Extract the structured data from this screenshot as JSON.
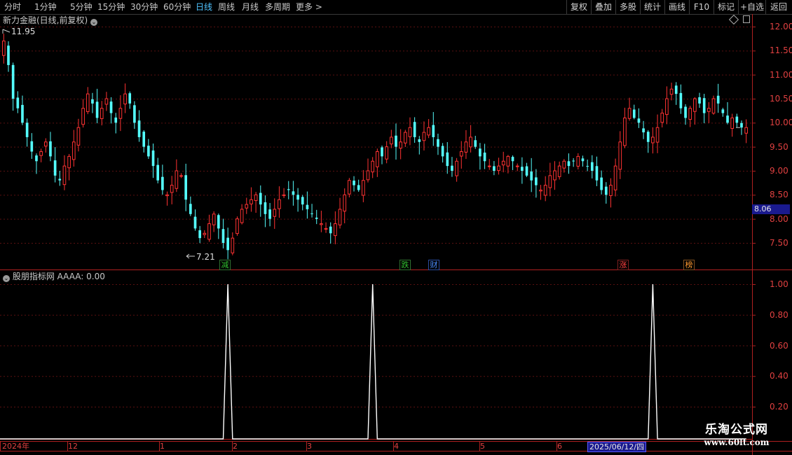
{
  "toolbar": {
    "periods": [
      "分时",
      "1分钟",
      "5分钟",
      "15分钟",
      "30分钟",
      "60分钟",
      "日线",
      "周线",
      "月线",
      "多周期",
      "更多 >"
    ],
    "active": "日线",
    "actions": [
      "复权",
      "叠加",
      "多股",
      "统计",
      "画线",
      "F10",
      "标记",
      "+自选",
      "返回"
    ]
  },
  "main_panel": {
    "title": "新力金融(日线,前复权)"
  },
  "indicator_panel": {
    "title": "股朋指标网  AAAA: 0.00"
  },
  "annotations": {
    "high": "11.95",
    "low": "7.21"
  },
  "price_tag": "8.06",
  "date_tag": "2025/06/12/四",
  "events": [
    {
      "label": "减",
      "color": "#30c030"
    },
    {
      "label": "跌",
      "color": "#30c030"
    },
    {
      "label": "财",
      "color": "#4a8cff"
    },
    {
      "label": "涨",
      "color": "#ff4040"
    },
    {
      "label": "榜",
      "color": "#ff9a30"
    }
  ],
  "x_axis": [
    "2024年",
    "12",
    "1",
    "2",
    "3",
    "4",
    "5",
    "6"
  ],
  "watermark": {
    "line1": "乐淘公式网",
    "line2": "www.60lt.com"
  },
  "chart_data": [
    {
      "type": "candlestick",
      "y_axis_ticks": [
        "12.00",
        "11.50",
        "11.00",
        "10.50",
        "10.00",
        "9.50",
        "9.00",
        "8.50",
        "8.00",
        "7.50"
      ],
      "ylim": [
        7.1,
        12.2
      ],
      "grid": true,
      "high_marker": 11.95,
      "low_marker": 7.21,
      "last_price": 8.06,
      "x_month_labels": [
        "2024年",
        "12",
        "1",
        "2",
        "3",
        "4",
        "5",
        "6"
      ],
      "up_color": "#ff3232",
      "down_color": "#54fcfc",
      "closes": [
        11.7,
        11.2,
        10.5,
        10.3,
        10.0,
        9.7,
        9.4,
        9.2,
        9.4,
        9.6,
        9.3,
        8.9,
        8.8,
        9.1,
        9.3,
        9.6,
        9.9,
        10.3,
        10.6,
        10.4,
        10.1,
        10.3,
        10.5,
        10.2,
        10.0,
        10.3,
        10.6,
        10.4,
        10.0,
        9.7,
        9.5,
        9.3,
        9.1,
        8.8,
        8.6,
        8.5,
        8.7,
        9.0,
        8.9,
        8.4,
        8.1,
        7.8,
        7.6,
        7.7,
        7.9,
        8.1,
        7.8,
        7.5,
        7.35,
        7.6,
        8.0,
        8.2,
        8.3,
        8.4,
        8.5,
        8.3,
        8.1,
        8.0,
        8.2,
        8.4,
        8.5,
        8.6,
        8.5,
        8.4,
        8.3,
        8.2,
        8.1,
        8.0,
        7.9,
        7.8,
        7.7,
        7.9,
        8.2,
        8.5,
        8.8,
        8.7,
        8.6,
        8.8,
        9.0,
        9.2,
        9.4,
        9.3,
        9.5,
        9.7,
        9.5,
        9.6,
        9.8,
        9.9,
        9.7,
        9.6,
        9.8,
        9.9,
        9.7,
        9.5,
        9.3,
        9.1,
        9.0,
        9.2,
        9.4,
        9.6,
        9.7,
        9.5,
        9.3,
        9.2,
        9.1,
        9.0,
        9.1,
        9.2,
        9.3,
        9.2,
        9.1,
        9.0,
        8.9,
        8.8,
        8.7,
        8.6,
        8.7,
        8.9,
        9.0,
        9.1,
        9.2,
        9.1,
        9.2,
        9.3,
        9.2,
        9.1,
        9.0,
        8.8,
        8.6,
        8.5,
        8.7,
        9.1,
        9.6,
        10.1,
        10.3,
        10.1,
        10.0,
        9.8,
        9.6,
        9.7,
        9.9,
        10.2,
        10.5,
        10.7,
        10.6,
        10.3,
        10.1,
        10.3,
        10.5,
        10.4,
        10.2,
        10.3,
        10.5,
        10.4,
        10.2,
        10.0,
        10.1,
        10.0,
        9.9,
        9.9
      ]
    },
    {
      "type": "line",
      "name": "AAAA",
      "y_axis_ticks": [
        "1.00",
        "0.80",
        "0.60",
        "0.40",
        "0.20"
      ],
      "ylim": [
        0,
        1.05
      ],
      "grid": true,
      "signal_days": [
        48,
        79,
        139
      ],
      "values_note_length": 168
    }
  ]
}
